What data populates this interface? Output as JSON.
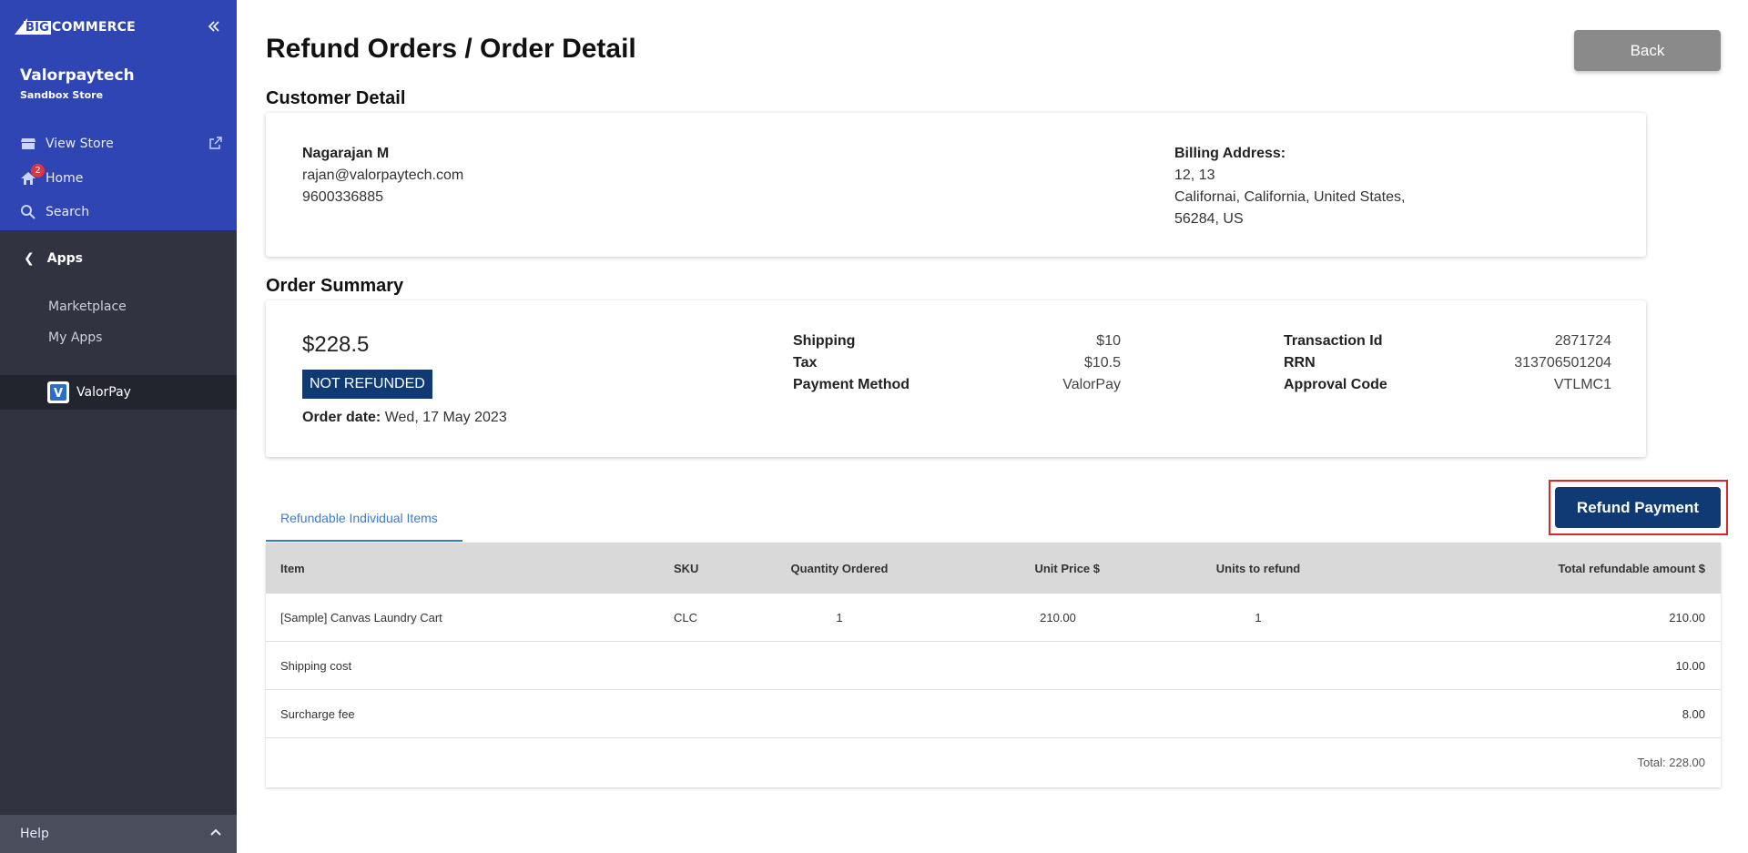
{
  "sidebar": {
    "brand": {
      "big": "BIG",
      "commerce": "COMMERCE"
    },
    "store_name": "Valorpaytech",
    "store_type": "Sandbox Store",
    "nav": {
      "view_store": "View Store",
      "home": "Home",
      "home_badge": "2",
      "search": "Search"
    },
    "apps_label": "Apps",
    "sub_items": {
      "marketplace": "Marketplace",
      "my_apps": "My Apps"
    },
    "app": {
      "name": "ValorPay",
      "logo_letter": "V"
    },
    "help": "Help"
  },
  "header": {
    "title": "Refund Orders / Order Detail",
    "back_label": "Back"
  },
  "customer": {
    "section_title": "Customer Detail",
    "name": "Nagarajan M",
    "email": "rajan@valorpaytech.com",
    "phone": "9600336885",
    "billing_label": "Billing Address:",
    "address_line1": "12, 13",
    "address_line2": "Californai, California, United States,",
    "address_line3": "56284, US"
  },
  "order": {
    "section_title": "Order Summary",
    "amount": "$228.5",
    "status": "NOT REFUNDED",
    "date_label": "Order date:",
    "date_value": "Wed, 17 May 2023",
    "shipping_label": "Shipping",
    "shipping_value": "$10",
    "tax_label": "Tax",
    "tax_value": "$10.5",
    "payment_label": "Payment Method",
    "payment_value": "ValorPay",
    "txn_label": "Transaction Id",
    "txn_value": "2871724",
    "rrn_label": "RRN",
    "rrn_value": "313706501204",
    "approval_label": "Approval Code",
    "approval_value": "VTLMC1"
  },
  "tabs": {
    "refundable": "Refundable Individual Items"
  },
  "refund_button": "Refund Payment",
  "table": {
    "headers": {
      "item": "Item",
      "sku": "SKU",
      "qty": "Quantity Ordered",
      "unit_price": "Unit Price $",
      "units_refund": "Units to refund",
      "total": "Total refundable amount $"
    },
    "rows": [
      {
        "item": "[Sample] Canvas Laundry Cart",
        "sku": "CLC",
        "qty": "1",
        "unit_price": "210.00",
        "units_refund": "1",
        "total": "210.00"
      },
      {
        "item": "Shipping cost",
        "total": "10.00"
      },
      {
        "item": "Surcharge fee",
        "total": "8.00"
      }
    ],
    "grand_total": "Total: 228.00"
  },
  "colors": {
    "sidebar": "#313440",
    "sidebar_top": "#3045b4",
    "primary": "#0f3a74",
    "highlight": "#d62a2a"
  }
}
